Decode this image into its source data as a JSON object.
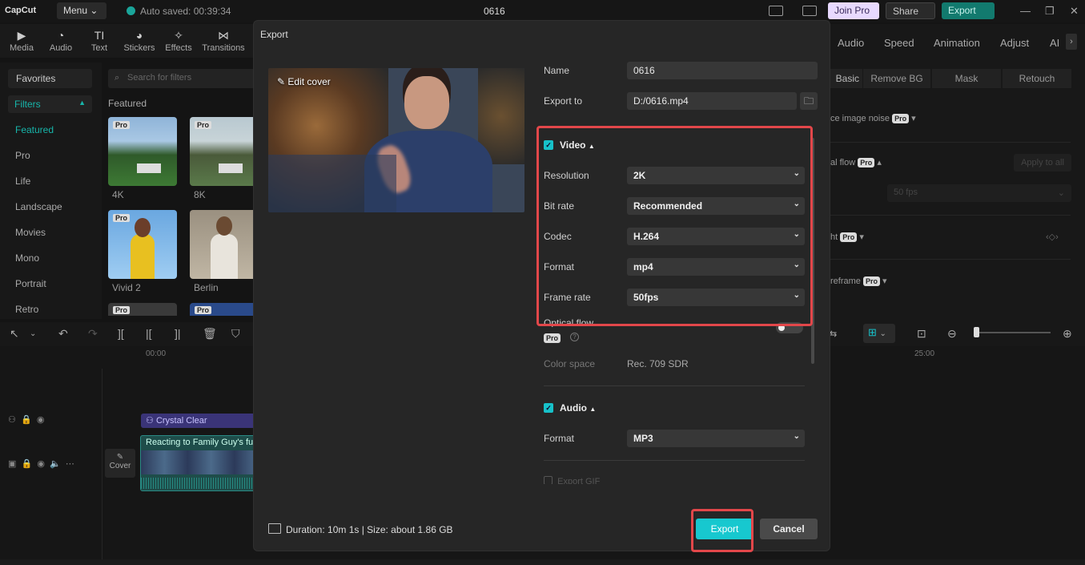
{
  "app": {
    "logo": "CapCut",
    "menu_label": "Menu",
    "autosave": "Auto saved: 00:39:34",
    "project_title": "0616",
    "join_pro": "Join Pro",
    "share": "Share",
    "export_top": "Export"
  },
  "toolbar": {
    "items": [
      "Media",
      "Audio",
      "Text",
      "Stickers",
      "Effects",
      "Transitions"
    ]
  },
  "sidebar": {
    "favorites": "Favorites",
    "filters": "Filters",
    "items": [
      "Featured",
      "Pro",
      "Life",
      "Landscape",
      "Movies",
      "Mono",
      "Portrait",
      "Retro"
    ]
  },
  "filters_panel": {
    "search_placeholder": "Search for filters",
    "heading": "Featured",
    "thumbs": [
      "4K",
      "8K",
      "Vivid 2",
      "Berlin"
    ],
    "pro_badge": "Pro"
  },
  "right_panel": {
    "tabs": [
      "Audio",
      "Speed",
      "Animation",
      "Adjust",
      "AI"
    ],
    "subtabs": [
      "Basic",
      "Remove BG",
      "Mask",
      "Retouch"
    ],
    "rows": [
      "ce image noise",
      "al flow",
      "ht",
      "reframe"
    ],
    "apply_all": "Apply to all",
    "fps": "50 fps"
  },
  "timeline": {
    "time_start": "00:00",
    "time_mark": "25:00",
    "audio_clip": "Crystal Clear",
    "video_clip": "Reacting to Family Guy's funn",
    "cover": "Cover"
  },
  "export_dialog": {
    "title": "Export",
    "edit_cover": "Edit cover",
    "name_label": "Name",
    "name_value": "0616",
    "export_to_label": "Export to",
    "export_to_value": "D:/0616.mp4",
    "video_section": "Video",
    "resolution_label": "Resolution",
    "resolution_value": "2K",
    "bitrate_label": "Bit rate",
    "bitrate_value": "Recommended",
    "codec_label": "Codec",
    "codec_value": "H.264",
    "format_label": "Format",
    "format_value": "mp4",
    "framerate_label": "Frame rate",
    "framerate_value": "50fps",
    "optical_flow_label": "Optical flow",
    "pro_badge": "Pro",
    "color_space_label": "Color space",
    "color_space_value": "Rec. 709 SDR",
    "audio_section": "Audio",
    "audio_format_label": "Format",
    "audio_format_value": "MP3",
    "export_gif_label": "Export GIF",
    "duration": "Duration: 10m 1s | Size: about 1.86 GB",
    "export_button": "Export",
    "cancel_button": "Cancel"
  },
  "colors": {
    "accent": "#17c8cf",
    "highlight": "#e2474a",
    "panel": "#262626"
  }
}
